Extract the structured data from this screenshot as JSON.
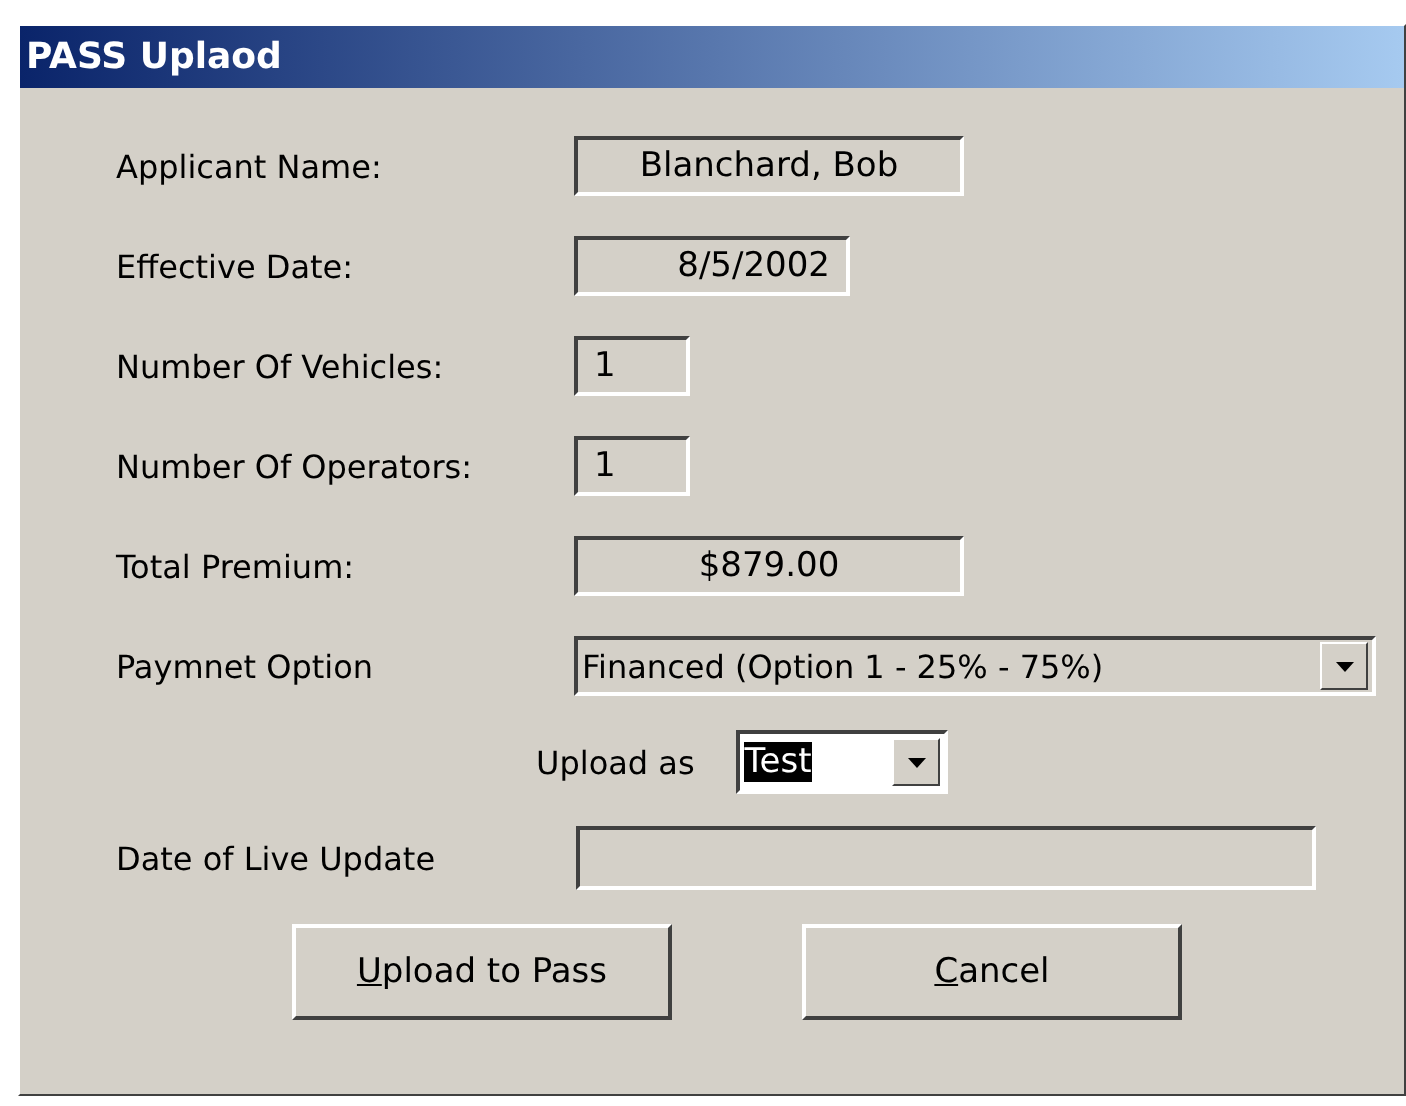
{
  "window": {
    "title": "PASS Uplaod"
  },
  "fields": [
    {
      "label": "Applicant Name:",
      "value": "Blanchard, Bob",
      "kind": "readonly"
    },
    {
      "label": "Effective Date:",
      "value": "8/5/2002",
      "kind": "readonly"
    },
    {
      "label": "Number Of Vehicles:",
      "value": "1",
      "kind": "readonly"
    },
    {
      "label": "Number Of Operators:",
      "value": "1",
      "kind": "readonly"
    },
    {
      "label": "Total Premium:",
      "value": "$879.00",
      "kind": "readonly"
    },
    {
      "label": "Paymnet Option",
      "value": "Financed (Option 1 - 25% -  75%)",
      "kind": "dropdown"
    }
  ],
  "upload_as": {
    "label": "Upload as",
    "value": "Test",
    "selected": true
  },
  "live_update": {
    "label": "Date of Live Update"
  },
  "buttons": [
    {
      "accel": "U",
      "rest": "pload to Pass"
    },
    {
      "accel": "C",
      "rest": "ancel"
    }
  ]
}
